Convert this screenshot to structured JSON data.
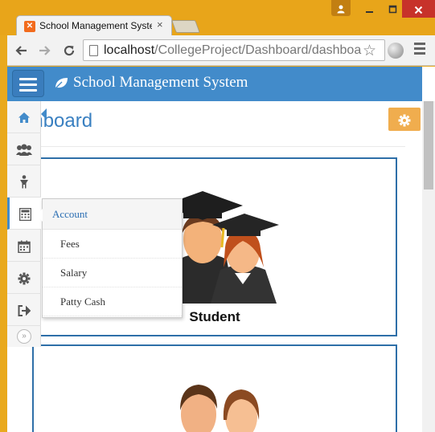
{
  "browser": {
    "tab_title": "School Management Syste",
    "tab_close": "×",
    "url_host": "localhost",
    "url_path": "/CollegeProject/Dashboard/dashboa"
  },
  "app": {
    "brand": "School Management System",
    "page_title": "ashboard"
  },
  "sidebar": {
    "items": [
      {
        "icon": "home-icon"
      },
      {
        "icon": "users-icon"
      },
      {
        "icon": "child-icon"
      },
      {
        "icon": "calculator-icon"
      },
      {
        "icon": "calendar-icon"
      },
      {
        "icon": "gear-icon"
      },
      {
        "icon": "sign-out-icon"
      }
    ],
    "collapse": "»"
  },
  "submenu": {
    "header": "Account",
    "items": [
      "Fees",
      "Salary",
      "Patty Cash"
    ]
  },
  "cards": [
    {
      "label": "Student"
    },
    {
      "label": ""
    }
  ],
  "colors": {
    "primary": "#428bca",
    "warning": "#f0ad4e",
    "title": "#3a80c1",
    "card_border": "#2e6fa8"
  }
}
